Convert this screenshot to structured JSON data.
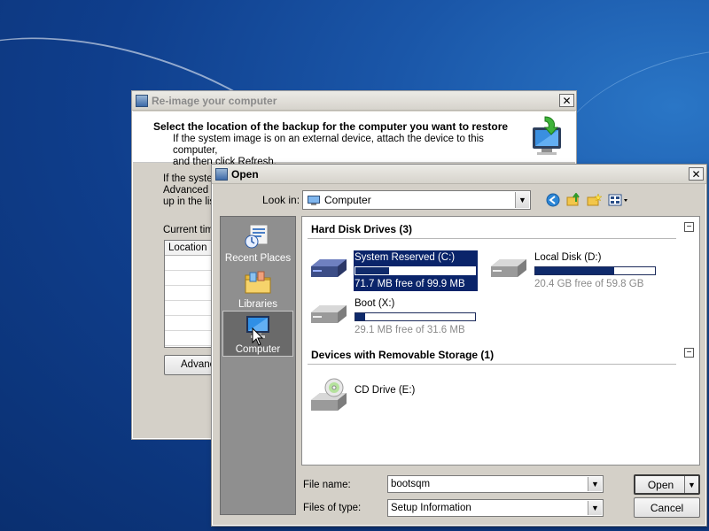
{
  "reimage_dialog": {
    "title": "Re-image your computer",
    "close_symbol": "✕",
    "heading": "Select the location of the backup for the computer you want to restore",
    "description_line1": "If the system image is on an external device, attach the device to this computer,",
    "description_line2": "and then click Refresh.",
    "body_text_line1": "If the syste",
    "body_text_line2": "Advanced t",
    "body_text_line3": "up in the lis",
    "current_time_label": "Current tim",
    "table_column_location": "Location",
    "advanced_button": "Advanc",
    "icons": [
      "restore-computer-icon"
    ]
  },
  "open_dialog": {
    "title": "Open",
    "close_symbol": "✕",
    "look_in_label": "Look in:",
    "look_in_value": "Computer",
    "toolbar_icons": [
      "back-icon",
      "up-folder-icon",
      "new-folder-icon",
      "view-menu-icon"
    ],
    "places": [
      {
        "label": "Recent Places",
        "icon": "recent-places-icon"
      },
      {
        "label": "Libraries",
        "icon": "libraries-icon"
      },
      {
        "label": "Computer",
        "icon": "computer-icon",
        "selected": true
      }
    ],
    "groups": {
      "hard_disks": {
        "header": "Hard Disk Drives (3)",
        "collapse_symbol": "−",
        "drives": [
          {
            "name": "System Reserved (C:)",
            "free": "71.7 MB free of 99.9 MB",
            "used_fraction": 0.28,
            "selected": true
          },
          {
            "name": "Local Disk (D:)",
            "free": "20.4 GB free of 59.8 GB",
            "used_fraction": 0.66
          },
          {
            "name": "Boot (X:)",
            "free": "29.1 MB free of 31.6 MB",
            "used_fraction": 0.08
          }
        ]
      },
      "removable": {
        "header": "Devices with Removable Storage (1)",
        "collapse_symbol": "−",
        "drives": [
          {
            "name": "CD Drive (E:)"
          }
        ]
      }
    },
    "file_name_label": "File name:",
    "file_name_value": "bootsqm",
    "file_type_label": "Files of type:",
    "file_type_value": "Setup Information",
    "open_button": "Open",
    "cancel_button": "Cancel",
    "dropdown_symbol": "▼"
  },
  "colors": {
    "selection": "#0a246a",
    "usage_fill": "#0f2a6b",
    "desktop": "#1a56a8"
  }
}
